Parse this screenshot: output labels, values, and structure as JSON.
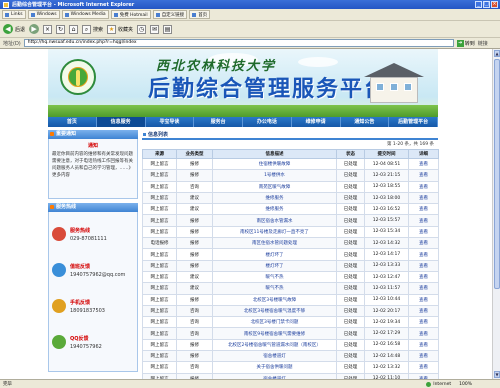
{
  "window": {
    "title": "后勤综合管理平台 - Microsoft Internet Explorer",
    "min": "_",
    "max": "□",
    "close": "×"
  },
  "favorites": [
    "Links",
    "Windows",
    "Windows Media",
    "免费 Hotmail",
    "自定义链接",
    "首页"
  ],
  "toolbar": {
    "back": "后退",
    "search": "搜索",
    "favorites": "收藏夹"
  },
  "address": {
    "label": "地址(D)",
    "url": "http://hq.nwsuaf.edu.cn/index.php?r=hqgl/index",
    "go": "转到",
    "links": "链接"
  },
  "banner": {
    "university": "西北农林科技大学",
    "system": "后勤综合管理服务平台"
  },
  "menu": [
    "首页",
    "信息服务",
    "寻宝导读",
    "服务台",
    "办公电话",
    "维修申请",
    "通知公告",
    "后勤管理平台"
  ],
  "sidebar": {
    "notice_title": "重要通知",
    "notice_heading": "通知",
    "notice_body": "最近你目前内容的维修和有关常发现问题需要注意，对于电话热线工作回报等有关问题服务人员和自己的学习管理，……》更多内容",
    "notice_more": "》更多内容",
    "hotline_title": "服务热线",
    "hotlines": [
      {
        "label": "服务热线",
        "value": "029-87081111",
        "color": "#d94b3a"
      },
      {
        "label": "值班反馈",
        "value": "1940757962@qq.com",
        "color": "#3a8fd9"
      },
      {
        "label": "手机反馈",
        "value": "18091837503",
        "color": "#e0a020"
      },
      {
        "label": "QQ反馈",
        "value": "1940757962",
        "color": "#5aaa3a"
      }
    ]
  },
  "list": {
    "title": "信息列表",
    "pager": "第 1-20 条，共 169 条",
    "columns": [
      "来源",
      "业务类型",
      "信息描述",
      "状态",
      "提交时间",
      "详细"
    ],
    "rows": [
      [
        "网上留言",
        "报修",
        "住宿楼供暖故障",
        "已处理",
        "12-04 08:51",
        "查看"
      ],
      [
        "网上留言",
        "报修",
        "1号楼供水",
        "已处理",
        "12-03 21:15",
        "查看"
      ],
      [
        "网上留言",
        "咨询",
        "南苑区暖气故障",
        "已处理",
        "12-03 18:55",
        "查看"
      ],
      [
        "网上留言",
        "建议",
        "维修服务",
        "已处理",
        "12-03 18:00",
        "查看"
      ],
      [
        "网上留言",
        "建议",
        "维修服务",
        "已处理",
        "12-03 16:52",
        "查看"
      ],
      [
        "网上留言",
        "报修",
        "南区宿舍水管漏水",
        "已处理",
        "12-03 15:57",
        "查看"
      ],
      [
        "网上留言",
        "报修",
        "南校区11号楼及走廊灯一直不亮了",
        "已处理",
        "12-03 15:34",
        "查看"
      ],
      [
        "电话报修",
        "报修",
        "南区住宿水管问题处理",
        "已处理",
        "12-03 14:32",
        "查看"
      ],
      [
        "网上留言",
        "报修",
        "楼灯坏了",
        "已处理",
        "12-03 14:17",
        "查看"
      ],
      [
        "网上留言",
        "报修",
        "楼灯坏了",
        "已处理",
        "12-03 13:33",
        "查看"
      ],
      [
        "网上留言",
        "建议",
        "暖气不热",
        "已处理",
        "12-03 12:47",
        "查看"
      ],
      [
        "网上留言",
        "建议",
        "暖气不热",
        "已处理",
        "12-03 11:57",
        "查看"
      ],
      [
        "网上留言",
        "报修",
        "北校区3号楼暖气故障",
        "已处理",
        "12-03 10:44",
        "查看"
      ],
      [
        "网上留言",
        "咨询",
        "北校区3号楼宿舍暖气温度不够",
        "已处理",
        "12-02 20:17",
        "查看"
      ],
      [
        "网上留言",
        "咨询",
        "北校区3号楼门禁卡问题",
        "已处理",
        "12-02 19:34",
        "查看"
      ],
      [
        "网上留言",
        "咨询",
        "南校区9号楼宿舍暖气需要维修",
        "已处理",
        "12-02 17:29",
        "查看"
      ],
      [
        "网上留言",
        "报修",
        "北校区2号楼宿舍暖气管道漏水问题（南校区）",
        "已处理",
        "12-02 16:58",
        "查看"
      ],
      [
        "网上留言",
        "报修",
        "宿舍楼道灯",
        "已处理",
        "12-02 14:48",
        "查看"
      ],
      [
        "网上留言",
        "咨询",
        "关于宿舍供暖问题",
        "已处理",
        "12-02 13:32",
        "查看"
      ],
      [
        "网上留言",
        "报修",
        "宿舍楼道灯",
        "已处理",
        "12-02 11:10",
        "查看"
      ]
    ]
  },
  "status": {
    "text": "完毕",
    "zone": "Internet",
    "zoom": "100%"
  }
}
